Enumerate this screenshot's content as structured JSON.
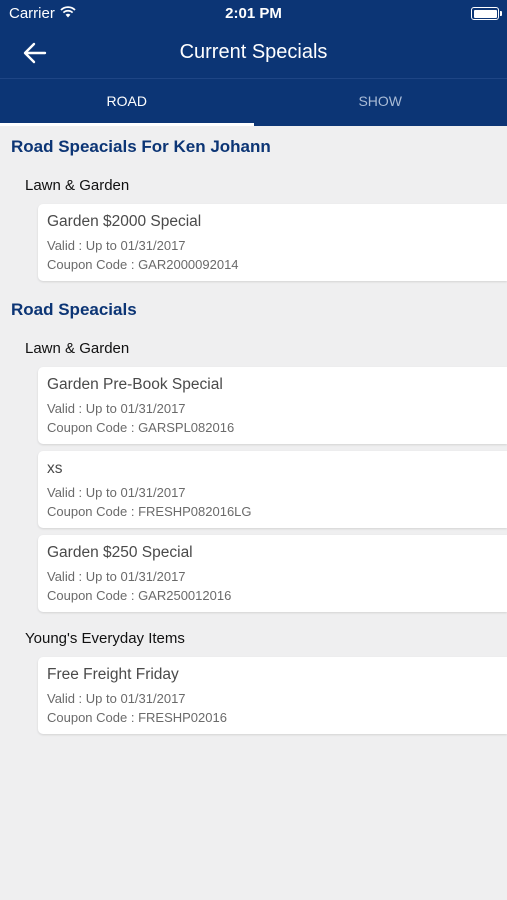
{
  "status_bar": {
    "carrier": "Carrier",
    "time": "2:01 PM"
  },
  "nav": {
    "title": "Current Specials"
  },
  "tabs": [
    {
      "label": "ROAD",
      "active": true
    },
    {
      "label": "SHOW",
      "active": false
    }
  ],
  "colors": {
    "primary": "#0c3575",
    "background": "#efeff0"
  },
  "sections": [
    {
      "title": "Road Speacials For Ken Johann",
      "groups": [
        {
          "name": "Lawn & Garden",
          "items": [
            {
              "title": "Garden $2000 Special",
              "valid": "Valid : Up to 01/31/2017",
              "code": "Coupon Code : GAR2000092014"
            }
          ]
        }
      ]
    },
    {
      "title": "Road Speacials",
      "groups": [
        {
          "name": "Lawn & Garden",
          "items": [
            {
              "title": "Garden Pre-Book Special",
              "valid": "Valid : Up to 01/31/2017",
              "code": "Coupon Code : GARSPL082016"
            },
            {
              "title": "xs",
              "valid": "Valid : Up to 01/31/2017",
              "code": "Coupon Code : FRESHP082016LG"
            },
            {
              "title": "Garden $250 Special",
              "valid": "Valid : Up to 01/31/2017",
              "code": "Coupon Code : GAR250012016"
            }
          ]
        },
        {
          "name": "Young's Everyday Items",
          "items": [
            {
              "title": "Free Freight Friday",
              "valid": "Valid : Up to 01/31/2017",
              "code": "Coupon Code : FRESHP02016"
            }
          ]
        }
      ]
    }
  ]
}
